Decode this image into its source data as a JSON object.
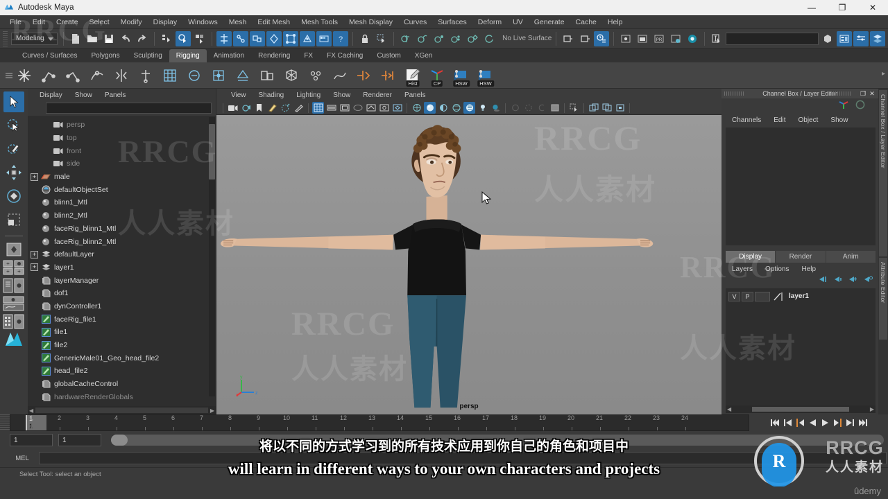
{
  "window": {
    "title": "Autodesk Maya",
    "minimize": "—",
    "maximize": "❐",
    "close": "✕"
  },
  "menubar": {
    "items": [
      "File",
      "Edit",
      "Create",
      "Select",
      "Modify",
      "Display",
      "Windows",
      "Mesh",
      "Edit Mesh",
      "Mesh Tools",
      "Mesh Display",
      "Curves",
      "Surfaces",
      "Deform",
      "UV",
      "Generate",
      "Cache",
      "Help"
    ]
  },
  "statusline": {
    "menuset": "Modeling",
    "live_surface": "No Live Surface"
  },
  "shelf": {
    "tabs": [
      "Curves / Surfaces",
      "Polygons",
      "Sculpting",
      "Rigging",
      "Animation",
      "Rendering",
      "FX",
      "FX Caching",
      "Custom",
      "XGen"
    ],
    "active_tab": "Rigging",
    "button_captions": [
      "Hist",
      "CP",
      "HSW",
      "HSW"
    ]
  },
  "outliner": {
    "menu": [
      "Display",
      "Show",
      "Panels"
    ],
    "search_value": "",
    "items": [
      {
        "label": "persp",
        "icon": "camera-icon",
        "dim": true,
        "expand": false,
        "indent": true
      },
      {
        "label": "top",
        "icon": "camera-icon",
        "dim": true,
        "expand": false,
        "indent": true
      },
      {
        "label": "front",
        "icon": "camera-icon",
        "dim": true,
        "expand": false,
        "indent": true
      },
      {
        "label": "side",
        "icon": "camera-icon",
        "dim": true,
        "expand": false,
        "indent": true
      },
      {
        "label": "male",
        "icon": "mesh-icon",
        "dim": false,
        "expand": true,
        "indent": false
      },
      {
        "label": "defaultObjectSet",
        "icon": "objectset-icon",
        "dim": false,
        "expand": false,
        "indent": true
      },
      {
        "label": "blinn1_Mtl",
        "icon": "material-icon",
        "dim": false,
        "expand": false,
        "indent": true
      },
      {
        "label": "blinn2_Mtl",
        "icon": "material-icon",
        "dim": false,
        "expand": false,
        "indent": true
      },
      {
        "label": "faceRig_blinn1_Mtl",
        "icon": "material-icon",
        "dim": false,
        "expand": false,
        "indent": true
      },
      {
        "label": "faceRig_blinn2_Mtl",
        "icon": "material-icon",
        "dim": false,
        "expand": false,
        "indent": true
      },
      {
        "label": "defaultLayer",
        "icon": "layer-icon",
        "dim": false,
        "expand": true,
        "indent": false
      },
      {
        "label": "layer1",
        "icon": "layer-icon",
        "dim": false,
        "expand": true,
        "indent": false
      },
      {
        "label": "layerManager",
        "icon": "node-icon",
        "dim": false,
        "expand": false,
        "indent": true
      },
      {
        "label": "dof1",
        "icon": "node-icon",
        "dim": false,
        "expand": false,
        "indent": true
      },
      {
        "label": "dynController1",
        "icon": "node-icon",
        "dim": false,
        "expand": false,
        "indent": true
      },
      {
        "label": "faceRig_file1",
        "icon": "file-texture-icon",
        "dim": false,
        "expand": false,
        "indent": true
      },
      {
        "label": "file1",
        "icon": "file-texture-icon",
        "dim": false,
        "expand": false,
        "indent": true
      },
      {
        "label": "file2",
        "icon": "file-texture-icon",
        "dim": false,
        "expand": false,
        "indent": true
      },
      {
        "label": "GenericMale01_Geo_head_file2",
        "icon": "file-texture-icon",
        "dim": false,
        "expand": false,
        "indent": true
      },
      {
        "label": "head_file2",
        "icon": "file-texture-icon",
        "dim": false,
        "expand": false,
        "indent": true
      },
      {
        "label": "globalCacheControl",
        "icon": "node-icon",
        "dim": false,
        "expand": false,
        "indent": true
      },
      {
        "label": "hardwareRenderGlobals",
        "icon": "node-icon",
        "dim": true,
        "expand": false,
        "indent": true
      }
    ]
  },
  "viewport": {
    "menu": [
      "View",
      "Shading",
      "Lighting",
      "Show",
      "Renderer",
      "Panels"
    ],
    "camera_label": "persp"
  },
  "channelbox": {
    "title": "Channel Box / Layer Editor",
    "restore_glyph": "❐",
    "close_glyph": "✕",
    "menu": [
      "Channels",
      "Edit",
      "Object",
      "Show"
    ]
  },
  "layer_editor": {
    "tabs": [
      "Display",
      "Render",
      "Anim"
    ],
    "active_tab": "Display",
    "menu": [
      "Layers",
      "Options",
      "Help"
    ],
    "rows": [
      {
        "visible": "V",
        "playback": "P",
        "shading": "",
        "name": "layer1"
      }
    ]
  },
  "dock_tabs": [
    "Channel Box / Layer Editor",
    "Attribute Editor"
  ],
  "timeline": {
    "ticks": [
      1,
      2,
      3,
      4,
      5,
      6,
      7,
      8,
      9,
      10,
      11,
      12,
      13,
      14,
      15,
      16,
      17,
      18,
      19,
      20,
      21,
      22,
      23,
      24
    ],
    "current_frame": "1",
    "current_frame_label": "1"
  },
  "range": {
    "start": "1",
    "end": "1"
  },
  "command_line": {
    "language": "MEL",
    "value": ""
  },
  "help_line": {
    "text": "Select Tool: select an object"
  },
  "subtitles": {
    "chinese": "将以不同的方式学习到的所有技术应用到你自己的角色和项目中",
    "english": "will learn in different ways to your own characters and projects"
  },
  "watermarks": {
    "brand_latin": "RRCG",
    "brand_cn": "人人素材",
    "udemy": "ûdemy"
  },
  "colors": {
    "accent_blue": "#2b6ea8",
    "panel_bg": "#3a3a3a",
    "list_bg": "#2e2e2e",
    "viewport_bg": "#909090",
    "text": "#c8c8c8"
  }
}
